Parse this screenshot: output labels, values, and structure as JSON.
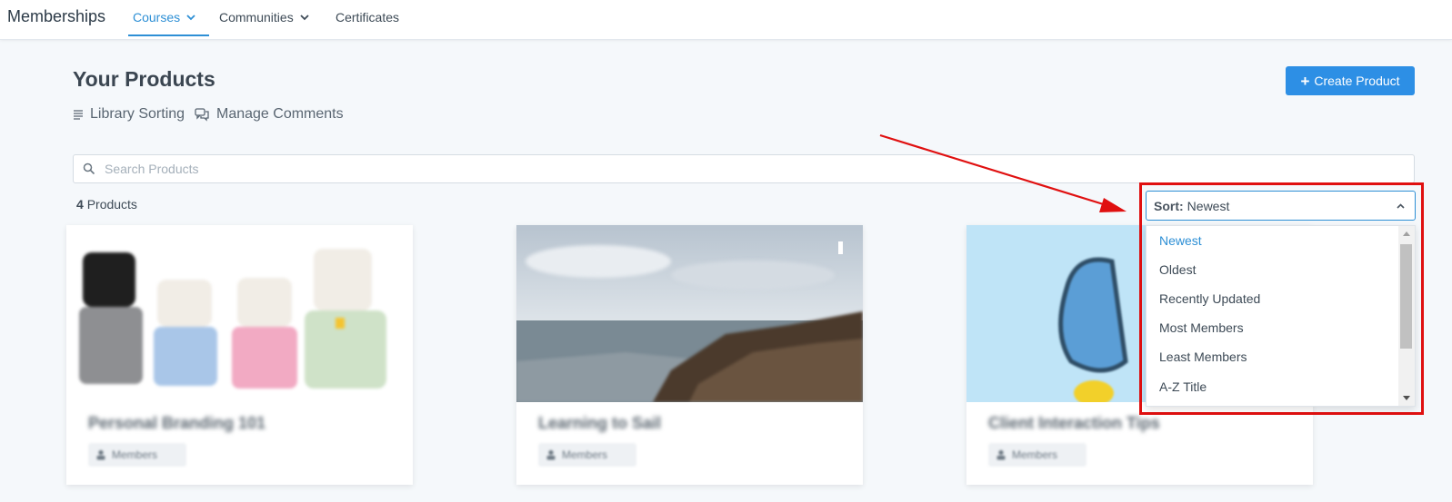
{
  "topbar": {
    "brand": "Memberships",
    "nav": [
      {
        "label": "Courses",
        "active": true,
        "has_chevron": true
      },
      {
        "label": "Communities",
        "active": false,
        "has_chevron": true
      },
      {
        "label": "Certificates",
        "active": false,
        "has_chevron": false
      }
    ]
  },
  "header": {
    "title": "Your Products",
    "library_sorting_label": "Library Sorting",
    "manage_comments_label": "Manage Comments",
    "create_button_label": "Create Product"
  },
  "search": {
    "placeholder": "Search Products",
    "value": ""
  },
  "products": {
    "count": "4",
    "count_label": "Products"
  },
  "cards": [
    {
      "title": "Personal Branding 101",
      "badge": "Members"
    },
    {
      "title": "Learning to Sail",
      "badge": "Members"
    },
    {
      "title": "Client Interaction Tips",
      "badge": "Members"
    }
  ],
  "sort": {
    "label": "Sort:",
    "value": "Newest",
    "options": [
      "Newest",
      "Oldest",
      "Recently Updated",
      "Most Members",
      "Least Members",
      "A-Z Title"
    ],
    "selected_index": 0
  },
  "colors": {
    "accent": "#2d8fd5",
    "button": "#2d8fe5",
    "highlight_box": "#e01010",
    "annotation_arrow": "#e01010"
  },
  "icons": {
    "nav_chevron": "chevron-down-icon",
    "library_sorting": "list-lines-icon",
    "manage_comments": "chat-bubbles-icon",
    "search": "search-icon",
    "create": "plus-icon",
    "sort_toggle": "chevron-up-icon",
    "card_badge": "person-icon"
  }
}
